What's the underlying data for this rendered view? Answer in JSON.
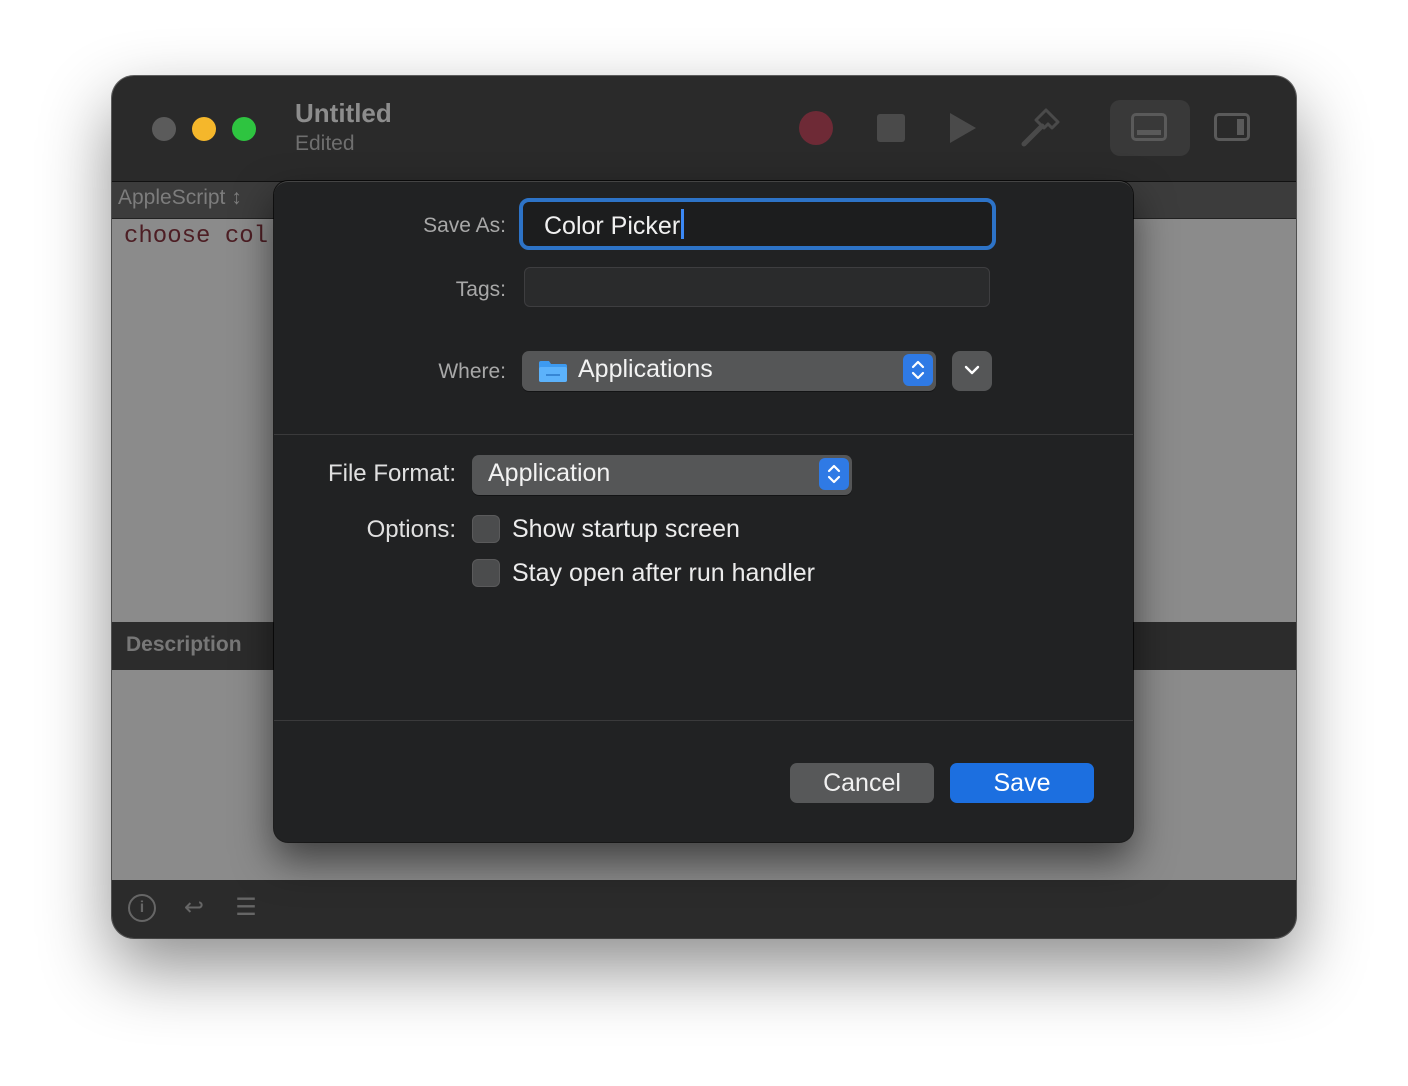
{
  "window": {
    "title": "Untitled",
    "subtitle": "Edited",
    "language": "AppleScript ↕",
    "code_visible": "choose col",
    "description_label": "Description"
  },
  "toolbar_icons": [
    "record-icon",
    "stop-icon",
    "run-icon",
    "compile-hammer-icon",
    "bottom-panel-icon",
    "side-panel-icon"
  ],
  "status_icons": [
    "info-icon",
    "return-icon",
    "list-icon"
  ],
  "save_dialog": {
    "save_as_label": "Save As:",
    "save_as_value": "Color Picker",
    "tags_label": "Tags:",
    "tags_value": "",
    "where_label": "Where:",
    "where_value": "Applications",
    "file_format_label": "File Format:",
    "file_format_value": "Application",
    "options_label": "Options:",
    "options": [
      {
        "label": "Show startup screen",
        "checked": false
      },
      {
        "label": "Stay open after run handler",
        "checked": false
      }
    ],
    "cancel_label": "Cancel",
    "save_label": "Save"
  },
  "colors": {
    "accent": "#2f7ae5",
    "focus_ring": "#2d73c7",
    "close": "#5b5b5b",
    "minimize": "#f5b72b",
    "zoom": "#2ec440"
  }
}
